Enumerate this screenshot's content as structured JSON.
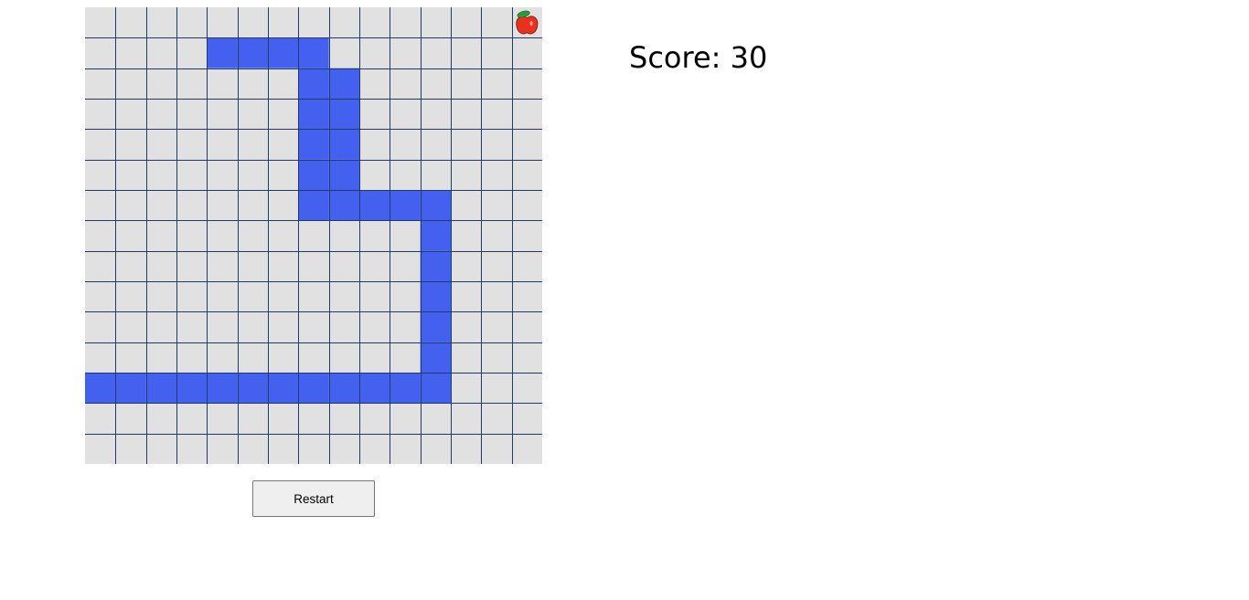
{
  "game": {
    "grid": {
      "cols": 15,
      "rows": 15
    },
    "colors": {
      "cell_background": "#e1e1e1",
      "grid_line": "#1f3a6b",
      "snake": "#4361ee",
      "apple": "#e8321f",
      "apple_leaf": "#2f9a3b"
    },
    "snake_cells": [
      [
        4,
        1
      ],
      [
        5,
        1
      ],
      [
        6,
        1
      ],
      [
        7,
        1
      ],
      [
        8,
        2
      ],
      [
        8,
        3
      ],
      [
        8,
        4
      ],
      [
        8,
        5
      ],
      [
        9,
        6
      ],
      [
        10,
        6
      ],
      [
        11,
        6
      ],
      [
        11,
        7
      ],
      [
        11,
        8
      ],
      [
        11,
        9
      ],
      [
        11,
        10
      ],
      [
        11,
        11
      ],
      [
        10,
        12
      ],
      [
        9,
        12
      ],
      [
        8,
        12
      ],
      [
        7,
        12
      ],
      [
        6,
        12
      ],
      [
        5,
        12
      ],
      [
        4,
        12
      ],
      [
        3,
        12
      ],
      [
        2,
        12
      ],
      [
        1,
        12
      ],
      [
        0,
        12
      ],
      [
        7,
        2
      ],
      [
        7,
        3
      ],
      [
        7,
        4
      ],
      [
        7,
        5
      ],
      [
        7,
        6
      ],
      [
        8,
        6
      ],
      [
        11,
        12
      ]
    ],
    "food": {
      "cell": [
        14,
        0
      ],
      "icon": "apple-icon"
    }
  },
  "score": {
    "label": "Score: 30"
  },
  "controls": {
    "restart_label": "Restart"
  }
}
